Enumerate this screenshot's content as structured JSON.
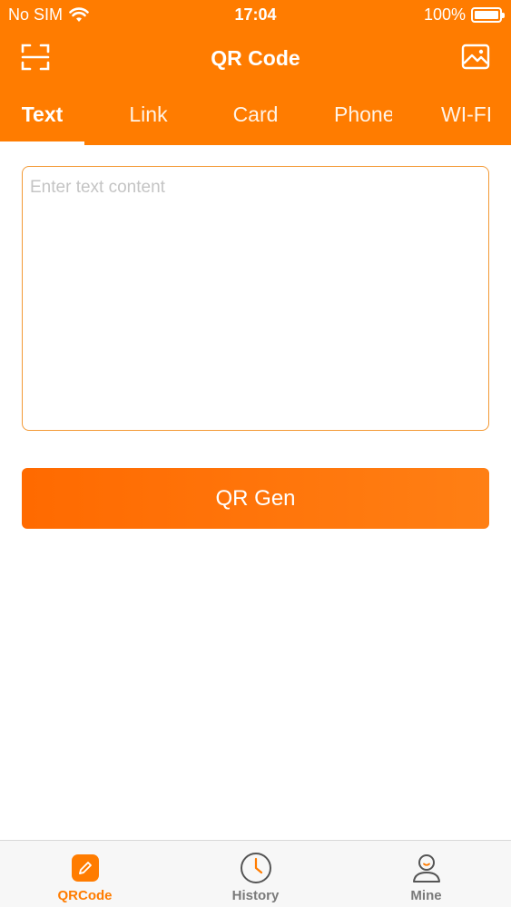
{
  "status_bar": {
    "carrier": "No SIM",
    "time": "17:04",
    "battery": "100%",
    "battery_level": 1.0
  },
  "nav": {
    "title": "QR Code",
    "left_icon": "scan-icon",
    "right_icon": "image-icon"
  },
  "tabs": [
    {
      "label": "Text",
      "active": true
    },
    {
      "label": "Link",
      "active": false
    },
    {
      "label": "Card",
      "active": false
    },
    {
      "label": "Phone",
      "active": false
    },
    {
      "label": "WI-FI",
      "active": false
    }
  ],
  "input": {
    "placeholder": "Enter text content",
    "value": ""
  },
  "generate_button": {
    "label": "QR Gen"
  },
  "bottom_tabs": [
    {
      "label": "QRCode",
      "icon": "pencil-icon",
      "active": true
    },
    {
      "label": "History",
      "icon": "clock-icon",
      "active": false
    },
    {
      "label": "Mine",
      "icon": "user-icon",
      "active": false
    }
  ],
  "colors": {
    "accent": "#ff7c00",
    "button": "#ff6a00",
    "input_border": "#f39a36",
    "tab_bar_bg": "#f7f7f7"
  }
}
